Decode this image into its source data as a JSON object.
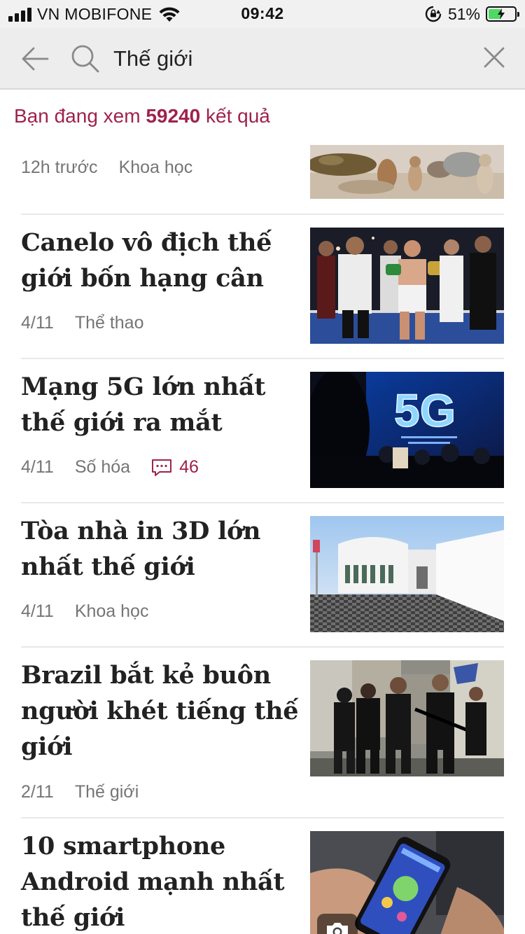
{
  "status_bar": {
    "carrier": "VN MOBIFONE",
    "time": "09:42",
    "battery_percent": "51%",
    "battery_level": 0.51,
    "battery_color": "#4cd964"
  },
  "search": {
    "query": "Thế giới",
    "back_icon": "back-arrow-icon",
    "search_icon": "search-icon",
    "clear_icon": "close-icon"
  },
  "results": {
    "prefix": "Bạn đang xem",
    "count": "59240",
    "suffix": "kết quả",
    "accent_color": "#9f224e"
  },
  "articles": [
    {
      "title": "",
      "time": "12h trước",
      "category": "Khoa học",
      "image": "animals-photo"
    },
    {
      "title": "Canelo vô địch thế giới bốn hạng cân",
      "time": "4/11",
      "category": "Thể thao",
      "image": "boxing-photo"
    },
    {
      "title": "Mạng 5G lớn nhất thế giới ra mắt",
      "time": "4/11",
      "category": "Số hóa",
      "comments": "46",
      "image": "5g-photo",
      "image_text": "5G"
    },
    {
      "title": "Tòa nhà in 3D lớn nhất thế giới",
      "time": "4/11",
      "category": "Khoa học",
      "image": "3d-building-photo"
    },
    {
      "title": "Brazil bắt kẻ buôn người khét tiếng thế giới",
      "time": "2/11",
      "category": "Thế giới",
      "image": "police-photo"
    },
    {
      "title": "10 smartphone Android mạnh nhất thế giới",
      "time": "",
      "category": "",
      "image": "smartphone-photo",
      "badge_icon": "camera-icon"
    }
  ]
}
